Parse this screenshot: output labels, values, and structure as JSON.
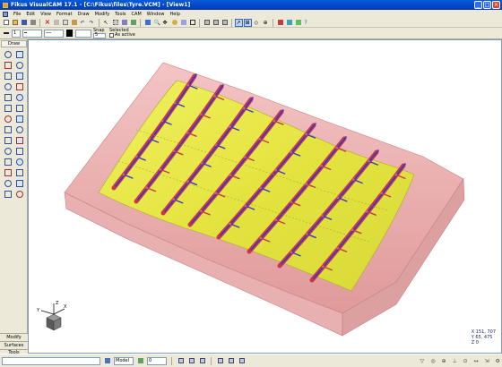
{
  "window": {
    "title": "Fikus VisualCAM 17.1 - [C:\\Fikus\\files\\Tyre.VCM] - [View1]"
  },
  "menu": [
    "File",
    "Edit",
    "View",
    "Format",
    "Draw",
    "Modify",
    "Tools",
    "CAM",
    "Window",
    "Help"
  ],
  "toolbar2": {
    "width_value": "1",
    "color_value": "",
    "snap_label": "Snap",
    "snap_value": "5",
    "selected_label": "Selected",
    "selected_value": "As active"
  },
  "leftpanel": {
    "tab_label": "Draw",
    "bottom_tabs": [
      "Modify",
      "Surfaces",
      "Tools"
    ]
  },
  "status": {
    "space_value": "Model",
    "layer_value": "0"
  },
  "readout": {
    "x": "X 151, 707",
    "y": "Y 65, 475",
    "z": "Z 0"
  },
  "triad": {
    "x_label": "X",
    "y_label": "Y",
    "z_label": "Z"
  },
  "colors": {
    "surface_yellow": "#e6e84a",
    "stock_pink": "#e8a8a8",
    "rib_red": "#c8384a",
    "groove_blue": "#3a38c8",
    "xp_blue": "#0046c8"
  }
}
